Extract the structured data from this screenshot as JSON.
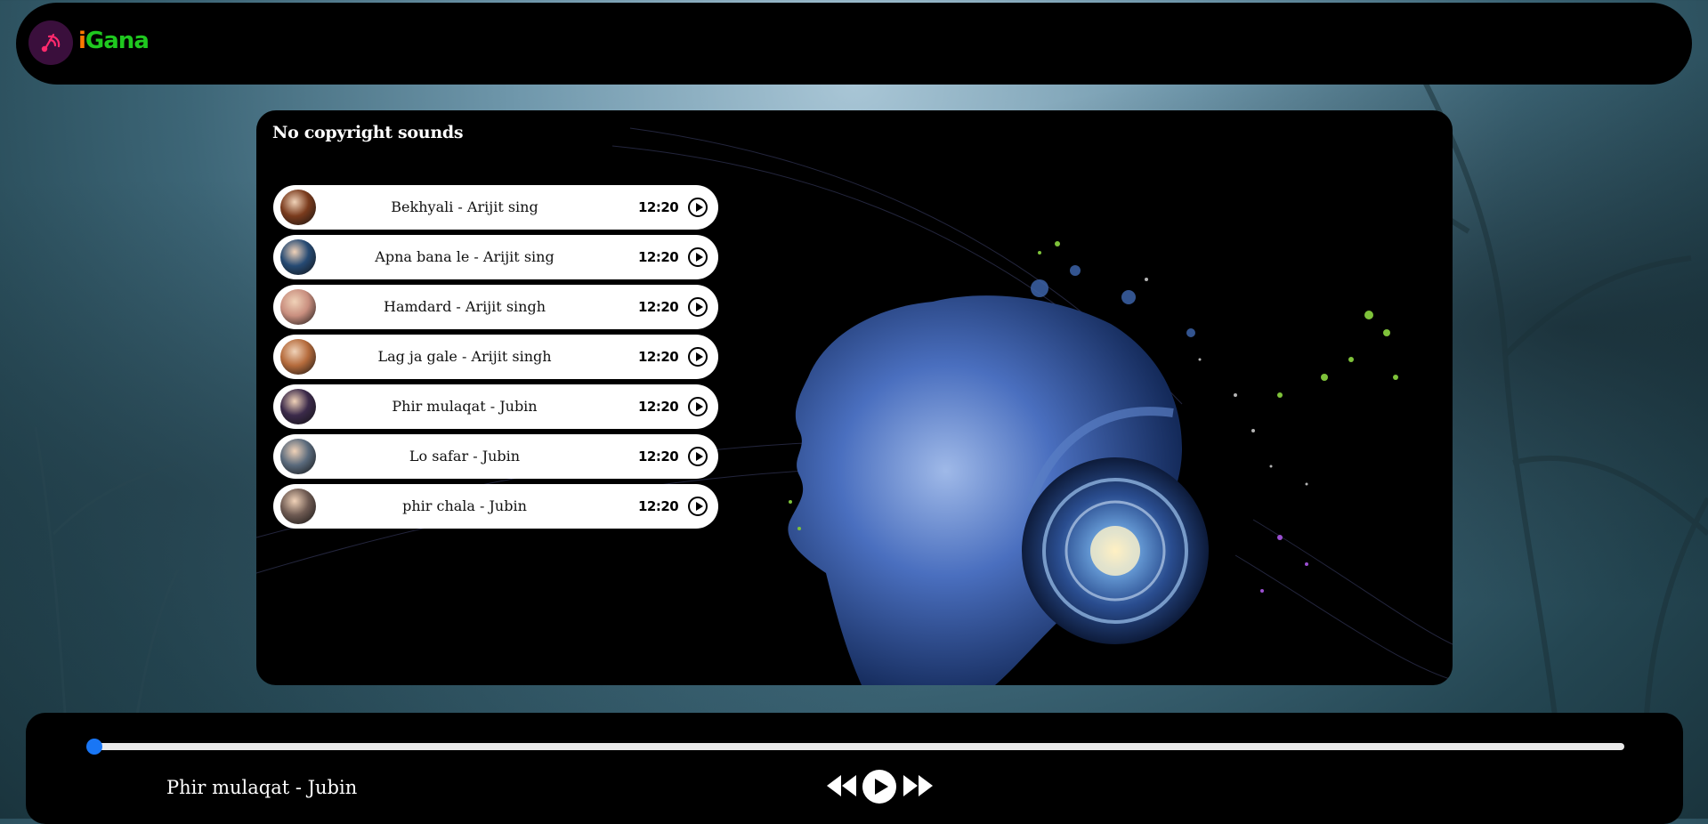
{
  "app": {
    "brand_i": "i",
    "brand_rest": "Gana"
  },
  "main": {
    "title": "No copyright sounds",
    "songs": [
      {
        "name": "Bekhyali - Arijit sing",
        "duration": "12:20",
        "color": "#7a3b1d"
      },
      {
        "name": "Apna bana le - Arijit sing",
        "duration": "12:20",
        "color": "#264a73"
      },
      {
        "name": "Hamdard - Arijit singh",
        "duration": "12:20",
        "color": "#c98f7f"
      },
      {
        "name": "Lag ja gale - Arijit singh",
        "duration": "12:20",
        "color": "#b56b3c"
      },
      {
        "name": "Phir mulaqat - Jubin",
        "duration": "12:20",
        "color": "#3b2a4a"
      },
      {
        "name": "Lo safar - Jubin",
        "duration": "12:20",
        "color": "#5a6a7c"
      },
      {
        "name": "phir chala - Jubin",
        "duration": "12:20",
        "color": "#6e5a52"
      }
    ]
  },
  "player": {
    "now_playing": "Phir mulaqat - Jubin",
    "progress": 0
  },
  "colors": {
    "accent": "#1976f5",
    "brand_i": "#ff7a00",
    "brand_rest": "#1fc81f",
    "logo_bg": "#3a0f3c",
    "logo_icon": "#ff2a6d"
  },
  "icons": {
    "logo": "music-disc-icon",
    "song_play": "play-circle-icon",
    "previous": "rewind-icon",
    "play": "play-icon",
    "next": "fast-forward-icon"
  }
}
